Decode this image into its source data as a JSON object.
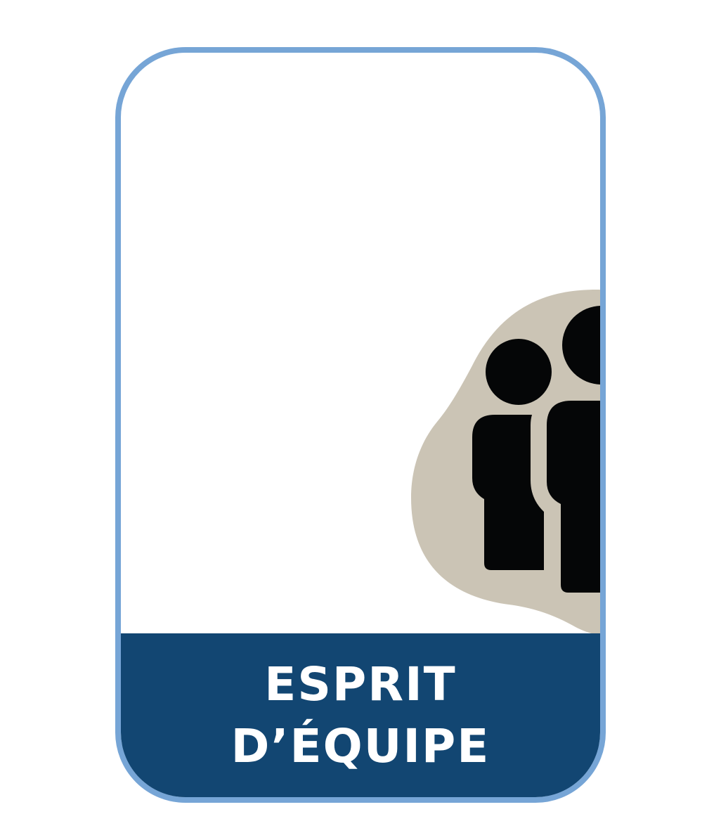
{
  "colors": {
    "frame_border": "#76a5d6",
    "card_background": "#ffffff",
    "label_band": "#124672",
    "label_text": "#ffffff",
    "blob": "#cbc4b5",
    "figures": "#050607"
  },
  "icon": {
    "name": "team-people-icon"
  },
  "label": {
    "line1": "ESPRIT",
    "line2": "D’ÉQUIPE"
  }
}
